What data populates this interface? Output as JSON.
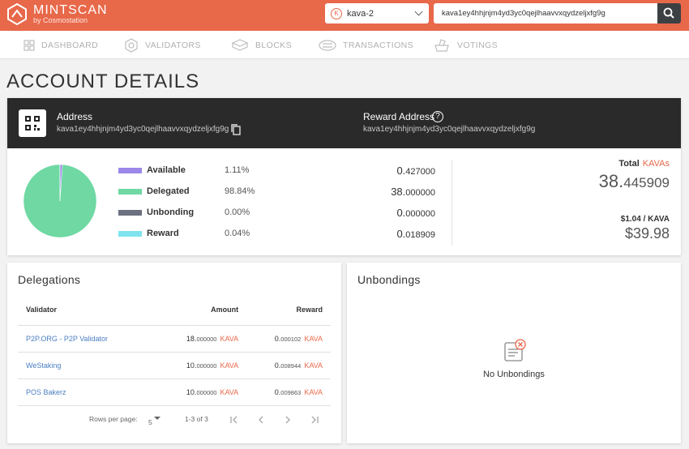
{
  "header": {
    "brand": "MINTSCAN",
    "brand_sub": "by Cosmostation",
    "chain": "kava-2",
    "chain_icon": "K",
    "search_value": "kava1ey4hhjnjm4yd3yc0qejlhaavvxqydzeljxfg9g",
    "accent_color": "#e8684a"
  },
  "nav": {
    "items": [
      "DASHBOARD",
      "VALIDATORS",
      "BLOCKS",
      "TRANSACTIONS",
      "VOTINGS"
    ]
  },
  "page": {
    "title": "ACCOUNT DETAILS"
  },
  "account": {
    "address_label": "Address",
    "address": "kava1ey4hhjnjm4yd3yc0qejlhaavvxqydzeljxfg9g",
    "reward_address_label": "Reward Address",
    "help_glyph": "?",
    "reward_address": "kava1ey4hhjnjm4yd3yc0qejlhaavvxqydzeljxfg9g"
  },
  "balances": {
    "rows": [
      {
        "name": "Available",
        "pct": "1.11%",
        "int": "0.",
        "dec": "427000",
        "color": "#9b88e8",
        "fraction": 0.0111
      },
      {
        "name": "Delegated",
        "pct": "98.84%",
        "int": "38.",
        "dec": "000000",
        "color": "#6fd8a3",
        "fraction": 0.9884
      },
      {
        "name": "Unbonding",
        "pct": "0.00%",
        "int": "0.",
        "dec": "000000",
        "color": "#6c7080",
        "fraction": 0.0
      },
      {
        "name": "Reward",
        "pct": "0.04%",
        "int": "0.",
        "dec": "018909",
        "color": "#7ee3ef",
        "fraction": 0.0004
      }
    ],
    "total_label": "Total",
    "total_unit": "KAVAs",
    "total_int": "38.",
    "total_dec": "445909",
    "price": "$1.04 / KAVA",
    "usd": "$39.98"
  },
  "delegations": {
    "title": "Delegations",
    "headers": {
      "validator": "Validator",
      "amount": "Amount",
      "reward": "Reward"
    },
    "rows": [
      {
        "validator": "P2P.ORG - P2P Validator",
        "amount_int": "18.",
        "amount_dec": "000000",
        "amount_unit": "KAVA",
        "reward_int": "0.",
        "reward_dec": "000102",
        "reward_unit": "KAVA"
      },
      {
        "validator": "WeStaking",
        "amount_int": "10.",
        "amount_dec": "000000",
        "amount_unit": "KAVA",
        "reward_int": "0.",
        "reward_dec": "008944",
        "reward_unit": "KAVA"
      },
      {
        "validator": "POS Bakerz",
        "amount_int": "10.",
        "amount_dec": "000000",
        "amount_unit": "KAVA",
        "reward_int": "0.",
        "reward_dec": "009863",
        "reward_unit": "KAVA"
      }
    ],
    "pager": {
      "rows_label": "Rows per page:",
      "rows_value": "5",
      "range": "1-3 of 3"
    }
  },
  "unbondings": {
    "title": "Unbondings",
    "empty": "No Unbondings"
  }
}
